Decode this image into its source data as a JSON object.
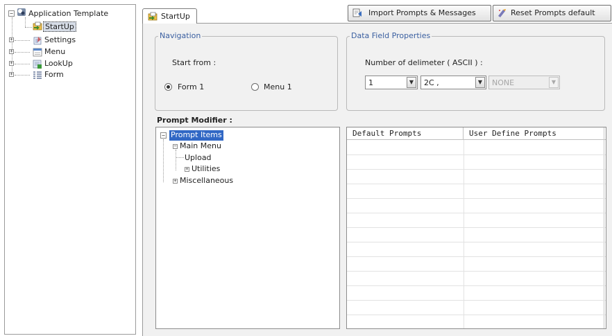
{
  "tree": {
    "root_label": "Application Template",
    "items": [
      {
        "label": "StartUp",
        "icon": "startup-icon"
      },
      {
        "label": "Settings",
        "icon": "settings-icon"
      },
      {
        "label": "Menu",
        "icon": "menu-icon"
      },
      {
        "label": "LookUp",
        "icon": "lookup-icon"
      },
      {
        "label": "Form",
        "icon": "form-icon"
      }
    ]
  },
  "tabs": [
    {
      "label": "StartUp"
    }
  ],
  "toolbar": {
    "import_label": "Import Prompts & Messages",
    "reset_label": "Reset Prompts default"
  },
  "navigation": {
    "legend": "Navigation",
    "start_label": "Start from :",
    "options": [
      {
        "label": "Form 1",
        "selected": true
      },
      {
        "label": "Menu 1",
        "selected": false
      }
    ]
  },
  "data_field": {
    "legend": "Data Field Properties",
    "delimiter_label": "Number of delimeter ( ASCII ) :",
    "combo1_value": "1",
    "combo2_value": "2C ,",
    "combo3_value": "NONE"
  },
  "prompt_modifier": {
    "title": "Prompt Modifier :",
    "tree": {
      "root": "Prompt Items",
      "main_menu": "Main Menu",
      "upload": "Upload",
      "utilities": "Utilities",
      "misc": "Miscellaneous"
    },
    "table": {
      "columns": [
        "Default Prompts",
        "User Define Prompts"
      ]
    }
  },
  "colors": {
    "selection": "#3168c5",
    "legend_text": "#3a5fa0",
    "panel_bg": "#f1f1f1"
  }
}
